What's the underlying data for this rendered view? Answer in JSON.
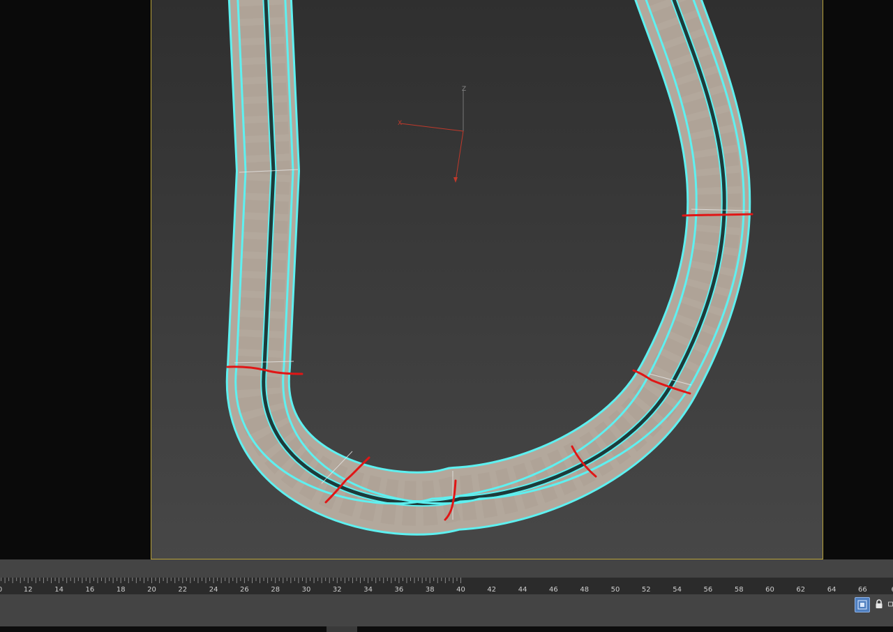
{
  "viewport": {
    "axis_gizmo": {
      "z_label": "Z",
      "x_label": "X"
    }
  },
  "timeline": {
    "ticks": [
      "0",
      "12",
      "14",
      "16",
      "18",
      "20",
      "22",
      "24",
      "26",
      "28",
      "30",
      "32",
      "34",
      "36",
      "38",
      "40",
      "42",
      "44",
      "46",
      "48",
      "50",
      "52",
      "54",
      "56",
      "58",
      "60",
      "62",
      "64",
      "66",
      "6"
    ]
  },
  "status": {
    "grid_icon": "grid-icon",
    "lock_icon": "lock-icon",
    "clipped_icon": "toolbar-icon"
  },
  "colors": {
    "selection_outline": "#5ef0f0",
    "annotation_red": "#e01616",
    "viewport_border": "#b8a23a",
    "road_fill": "#b3a89c"
  }
}
